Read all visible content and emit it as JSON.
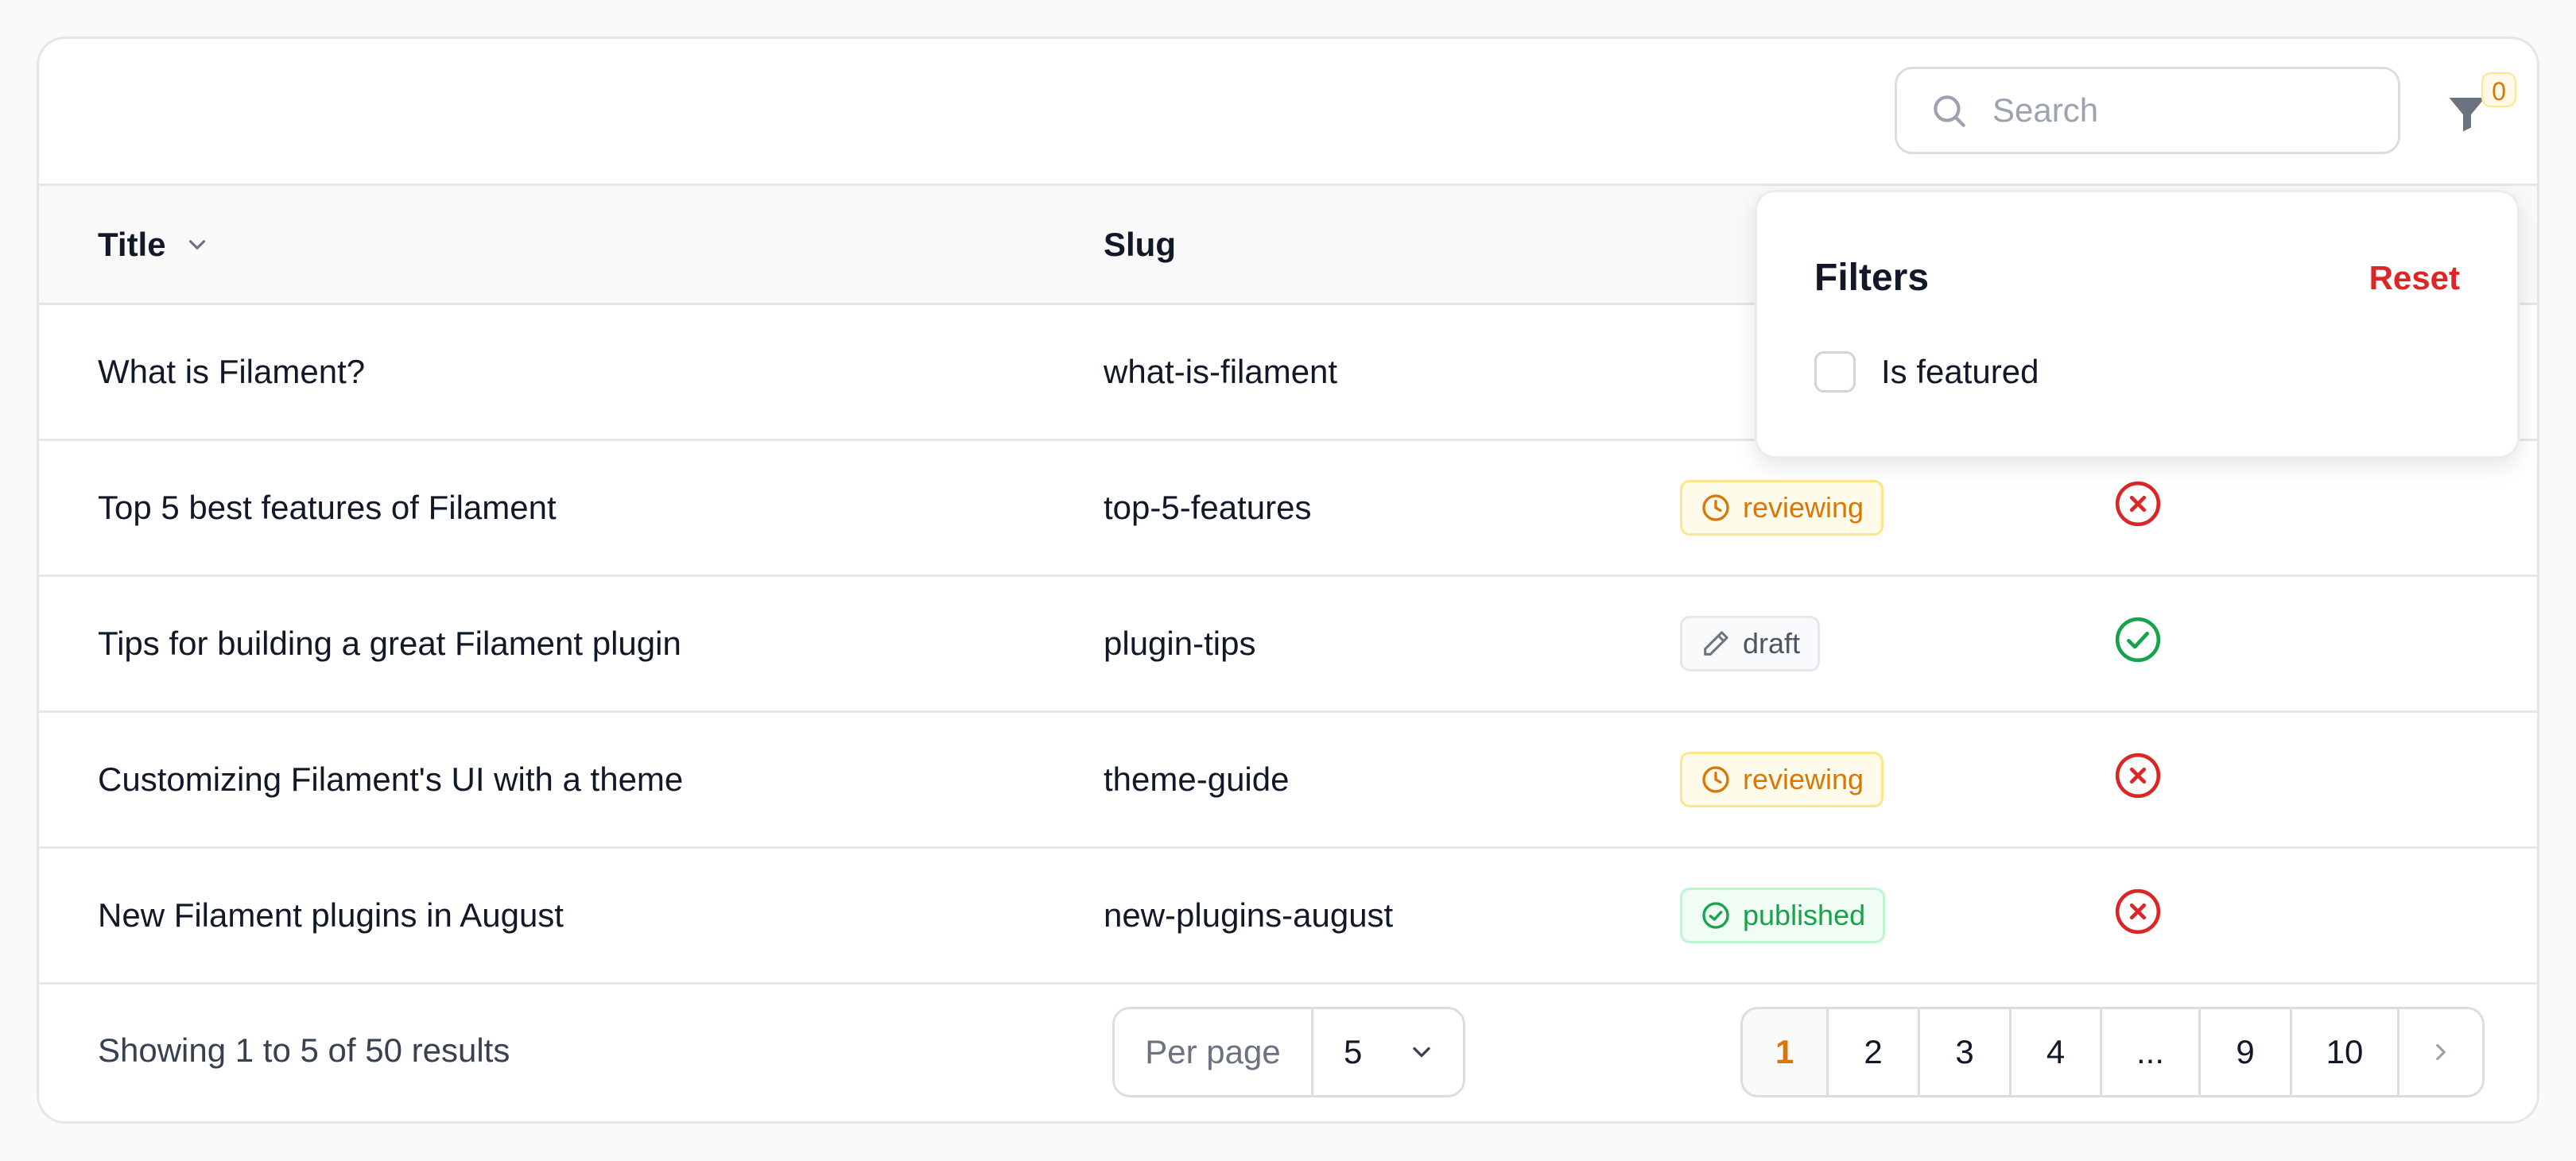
{
  "search": {
    "placeholder": "Search"
  },
  "filters": {
    "active_count": "0",
    "title": "Filters",
    "reset_label": "Reset",
    "options": [
      {
        "label": "Is featured",
        "checked": false
      }
    ]
  },
  "table": {
    "columns": {
      "title": "Title",
      "slug": "Slug"
    },
    "rows": [
      {
        "title": "What is Filament?",
        "slug": "what-is-filament",
        "status": "",
        "featured": ""
      },
      {
        "title": "Top 5 best features of Filament",
        "slug": "top-5-features",
        "status": "reviewing",
        "featured": "no"
      },
      {
        "title": "Tips for building a great Filament plugin",
        "slug": "plugin-tips",
        "status": "draft",
        "featured": "yes"
      },
      {
        "title": "Customizing Filament's UI with a theme",
        "slug": "theme-guide",
        "status": "reviewing",
        "featured": "no"
      },
      {
        "title": "New Filament plugins in August",
        "slug": "new-plugins-august",
        "status": "published",
        "featured": "no"
      }
    ]
  },
  "footer": {
    "showing": "Showing 1 to 5 of 50 results",
    "per_page_label": "Per page",
    "per_page_value": "5",
    "pages": [
      "1",
      "2",
      "3",
      "4",
      "...",
      "9",
      "10"
    ],
    "current_page": "1"
  },
  "colors": {
    "accent": "#d97706",
    "danger": "#dc2626",
    "success": "#16a34a",
    "muted": "#6b7280"
  },
  "icons": {
    "search": "search-icon",
    "filter": "funnel-icon",
    "sort": "chevron-down-icon",
    "reviewing": "clock-icon",
    "draft": "pencil-icon",
    "published": "check-circle-icon",
    "featured_yes": "check-circle-icon",
    "featured_no": "x-circle-icon",
    "next": "chevron-right-icon"
  }
}
